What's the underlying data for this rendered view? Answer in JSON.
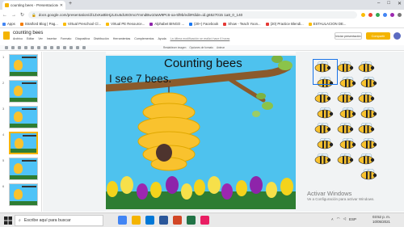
{
  "browser": {
    "tab_title": "counting bees - Presentaciones ...",
    "url": "docs.google.com/presentation/d/1ZxKaBkHjJLEu5dU6Omo7mmdBw10aW9Pc6-oa-5f9b/edit#slide=id.g6527015 1a8_0_140",
    "bookmarks": [
      "Apps",
      "Stratford Blog | Pag...",
      "Virtual Preschool Cl...",
      "Virtual PE Resource...",
      "Alphabet BINGO ...",
      "(20+) Facebook",
      "Show - Teach Yoon...",
      "(20) Practice Blendi...",
      "ESTAULACION DE..."
    ]
  },
  "slides_app": {
    "doc_title": "counting bees",
    "menu": [
      "Archivo",
      "Editar",
      "Ver",
      "Insertar",
      "Formato",
      "Diapositiva",
      "Distribución",
      "Herramientas",
      "Complementos",
      "Ayuda"
    ],
    "last_edit": "La última modificación se realizó hace 6 horas",
    "present_label": "Iniciar presentación",
    "share_label": "Compartir",
    "toolbar_labels": [
      "Restablecer imagen",
      "Opciones de formato",
      "Animar"
    ]
  },
  "filmstrip": {
    "slide_numbers": [
      "1",
      "2",
      "3",
      "4",
      "5",
      "6"
    ],
    "selected_index": 3
  },
  "slide": {
    "title": "Counting bees",
    "subtitle": "I see 7 bees.",
    "bee_count_on_slide": 7
  },
  "overlay": {
    "activate_title": "Activar Windows",
    "activate_sub": "Ve a Configuración para activar Windows."
  },
  "taskbar": {
    "search_placeholder": "Escribe aquí para buscar",
    "language": "ESP",
    "time": "03:52 p. m.",
    "date": "10/05/2021"
  },
  "colors": {
    "sky": "#4ec2ee",
    "hive": "#f9c22e",
    "branch": "#8b5a2b",
    "accent": "#f4b400"
  }
}
